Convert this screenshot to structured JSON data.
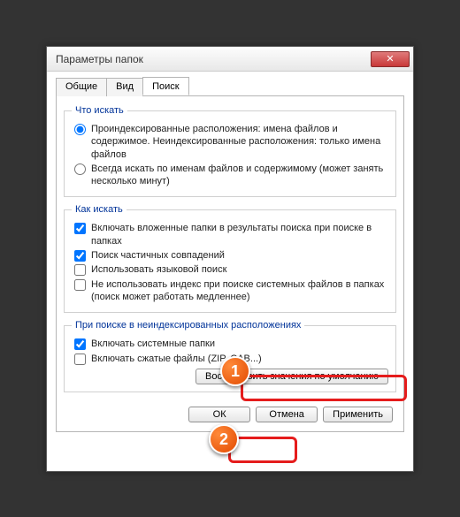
{
  "window": {
    "title": "Параметры папок"
  },
  "tabs": {
    "general": "Общие",
    "view": "Вид",
    "search": "Поиск"
  },
  "group_what": {
    "legend": "Что искать",
    "opt_indexed": "Проиндексированные расположения: имена файлов и содержимое. Неиндексированные расположения: только имена файлов",
    "opt_always": "Всегда искать по именам файлов и содержимому (может занять несколько минут)"
  },
  "group_how": {
    "legend": "Как искать",
    "opt_subfolders": "Включать вложенные папки в результаты поиска при поиске в папках",
    "opt_partial": "Поиск частичных совпадений",
    "opt_nlq": "Использовать языковой поиск",
    "opt_noindex": "Не использовать индекс при поиске системных файлов в папках (поиск может работать медленнее)"
  },
  "group_nonindexed": {
    "legend": "При поиске в неиндексированных расположениях",
    "opt_system": "Включать системные папки",
    "opt_compressed": "Включать сжатые файлы (ZIP, CAB...)"
  },
  "buttons": {
    "restore": "Восстановить значения по умолчанию",
    "ok": "ОК",
    "cancel": "Отмена",
    "apply": "Применить"
  },
  "badges": {
    "one": "1",
    "two": "2"
  }
}
